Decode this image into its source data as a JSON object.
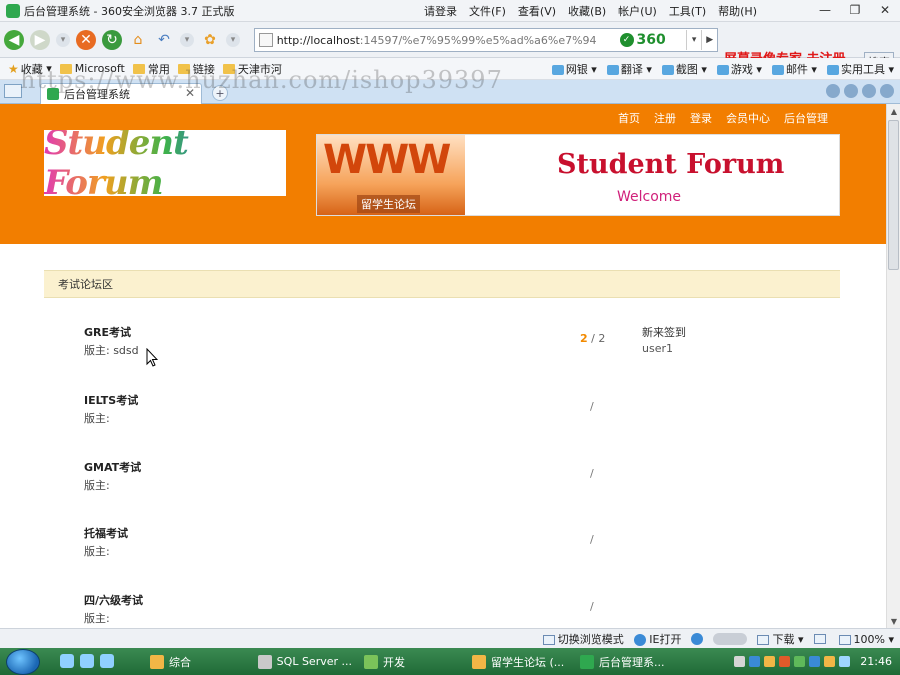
{
  "browser": {
    "window_title": "后台管理系统 - 360安全浏览器 3.7 正式版",
    "menus": [
      "请登录",
      "文件(F)",
      "查看(V)",
      "收藏(B)",
      "帐户(U)",
      "工具(T)",
      "帮助(H)"
    ],
    "url_host": "http://localhost",
    "url_rest": ":14597/%e7%95%99%e5%ad%a6%e7%94",
    "safety_badge": "360",
    "recorder_watermark": "屏幕录像专家 未注册",
    "search_label": "搜索",
    "bookmarks": [
      "收藏",
      "Microsoft",
      "常用",
      "链接",
      "天津市河"
    ],
    "toolbar_right": [
      "网银",
      "翻译",
      "截图",
      "游戏",
      "邮件",
      "实用工具"
    ],
    "overlay_watermark": "https://www.huzhan.com/ishop39397",
    "tab_title": "后台管理系统",
    "status": {
      "switch_mode": "切换浏览模式",
      "ie_open": "IE打开",
      "download": "下载",
      "zoom": "100%"
    }
  },
  "site": {
    "nav": [
      "首页",
      "注册",
      "登录",
      "会员中心",
      "后台管理"
    ],
    "logo_text": "Student Forum",
    "banner": {
      "www": "WWW",
      "sub": "留学生论坛",
      "title": "Student Forum",
      "welcome": "Welcome"
    },
    "section_title": "考试论坛区",
    "forums": [
      {
        "name": "GRE考试",
        "moderator": "版主: sdsd",
        "counts_hi": "2",
        "counts_sep": " / ",
        "counts_total": "2",
        "latest_label": "新来签到",
        "latest_user": "user1"
      },
      {
        "name": "IELTS考试",
        "moderator": "版主:",
        "slash": "/"
      },
      {
        "name": "GMAT考试",
        "moderator": "版主:",
        "slash": "/"
      },
      {
        "name": "托福考试",
        "moderator": "版主:",
        "slash": "/"
      },
      {
        "name": "四/六级考试",
        "moderator": "版主:",
        "slash": "/"
      }
    ]
  },
  "taskbar": {
    "items": [
      "综合",
      "SQL Server ...",
      "开发",
      "留学生论坛 (...",
      "后台管理系..."
    ],
    "clock": "21:46"
  },
  "colors": {
    "header_orange": "#f27e00",
    "section_bg": "#fbf1cf",
    "count_highlight": "#f28a00",
    "banner_title_red": "#c8102e"
  }
}
